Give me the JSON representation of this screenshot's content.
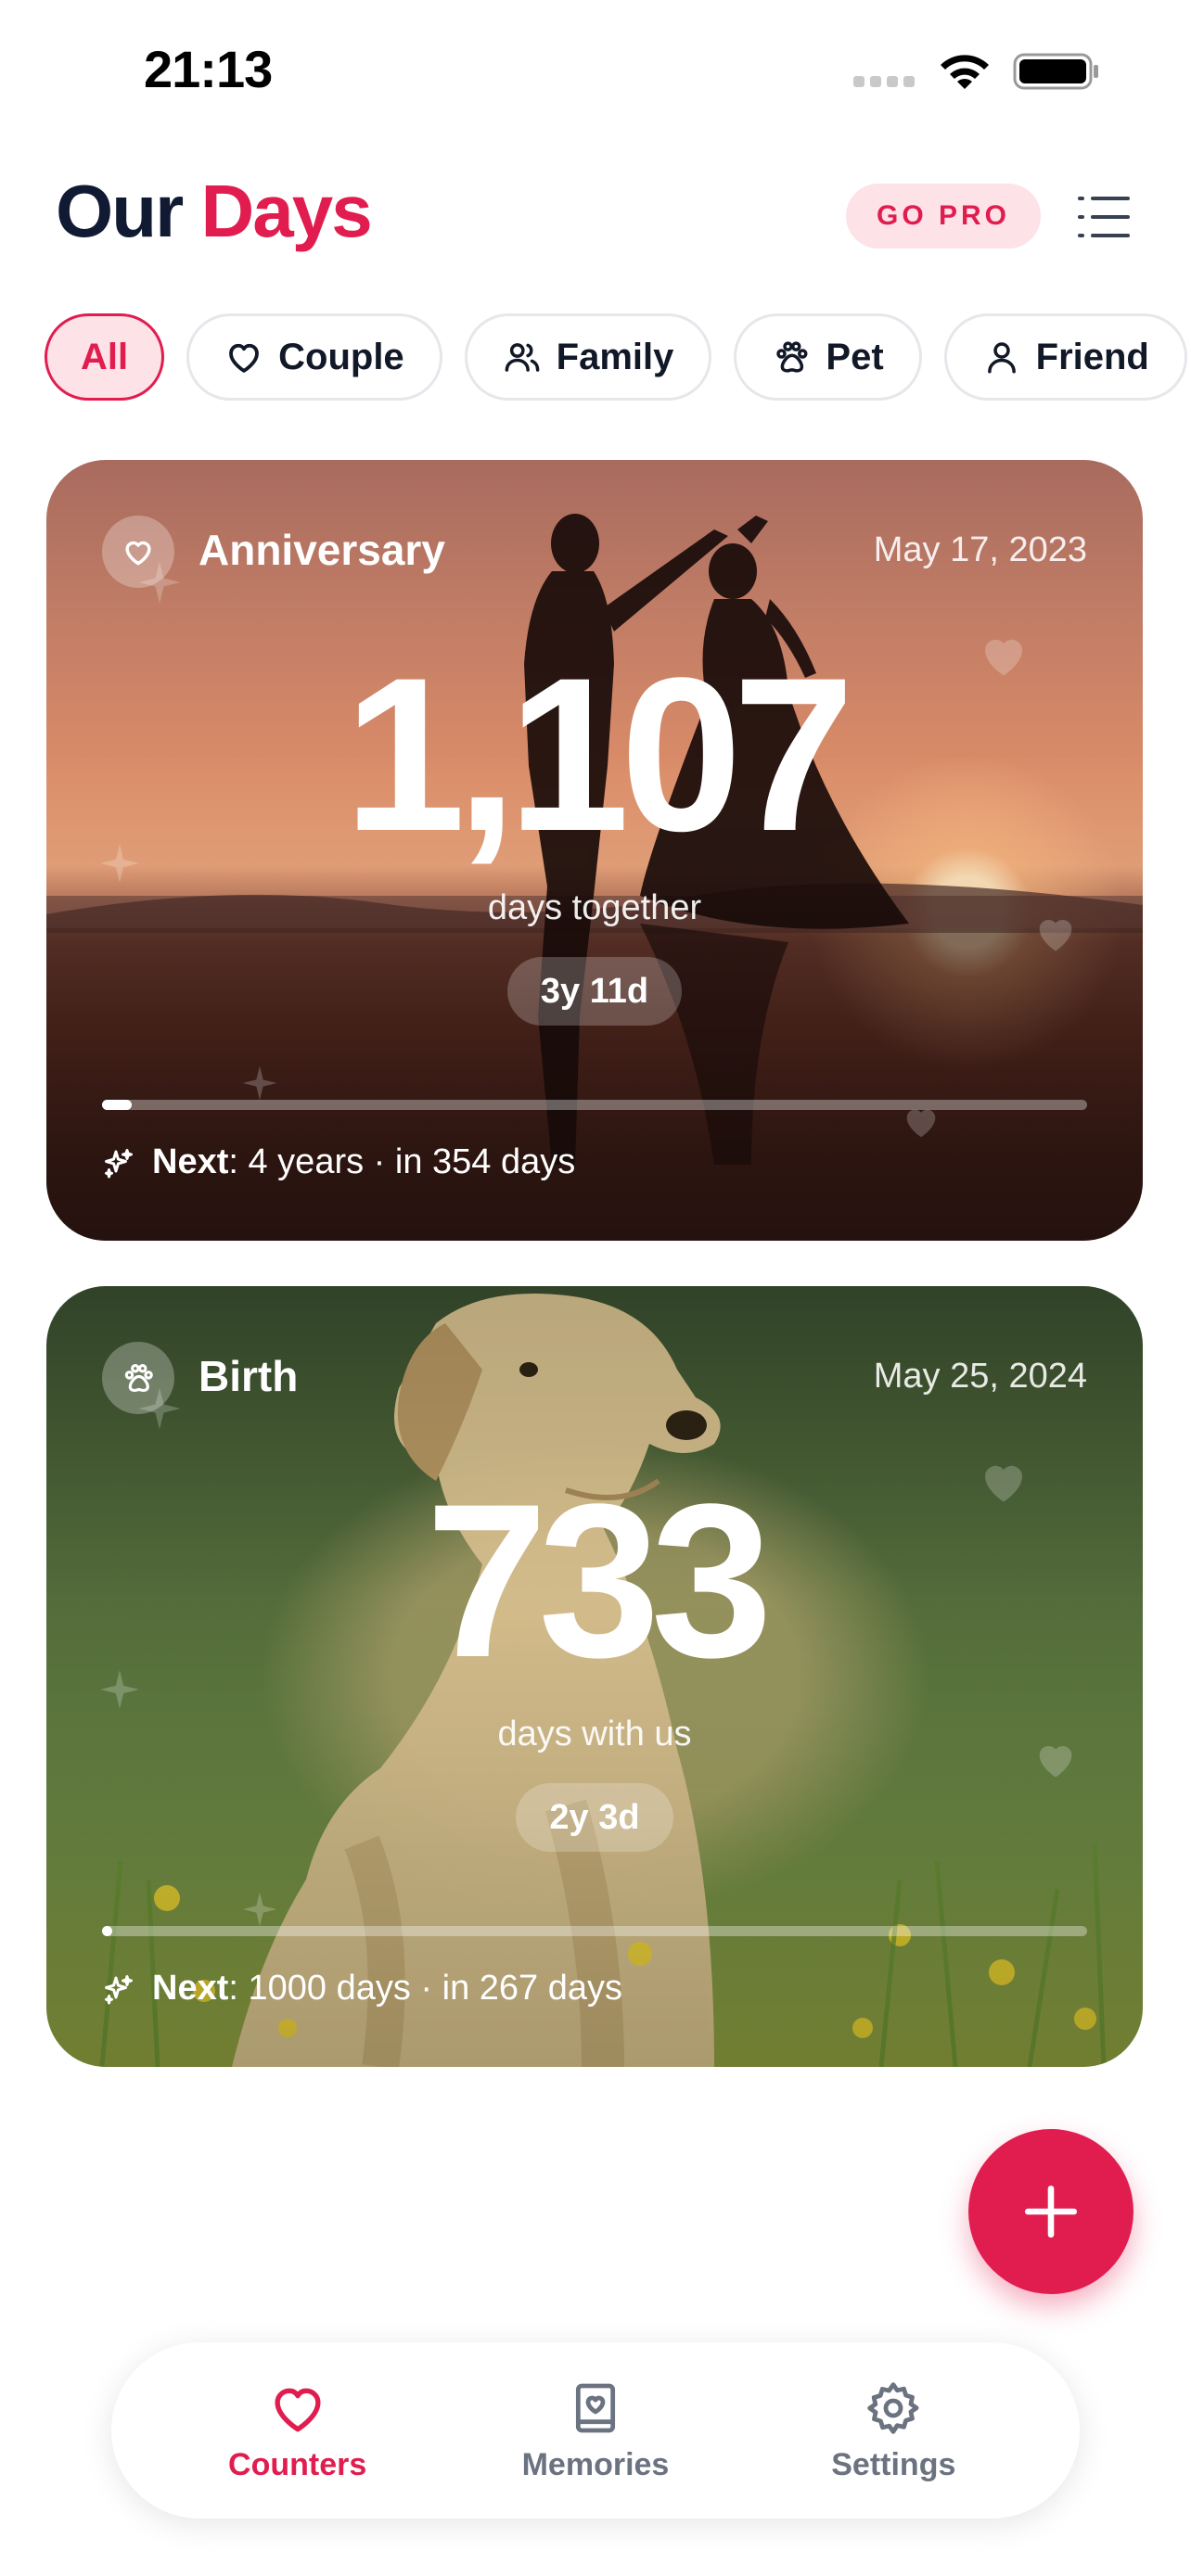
{
  "status_bar": {
    "time": "21:13"
  },
  "header": {
    "title_part1": "Our",
    "title_part2": "Days",
    "go_pro_label": "GO PRO"
  },
  "filters": [
    {
      "label": "All",
      "icon": "none",
      "active": true
    },
    {
      "label": "Couple",
      "icon": "heart-icon",
      "active": false
    },
    {
      "label": "Family",
      "icon": "people-icon",
      "active": false
    },
    {
      "label": "Pet",
      "icon": "paw-icon",
      "active": false
    },
    {
      "label": "Friend",
      "icon": "person-icon",
      "active": false
    }
  ],
  "cards": [
    {
      "label": "Anniversary",
      "icon": "heart-icon",
      "date": "May 17, 2023",
      "count": "1,107",
      "subtitle": "days together",
      "duration": "3y 11d",
      "progress": 0.03,
      "next_label": "Next",
      "next_text": ": 4 years · in 354 days"
    },
    {
      "label": "Birth",
      "icon": "paw-icon",
      "date": "May 25, 2024",
      "count": "733",
      "subtitle": "days with us",
      "duration": "2y 3d",
      "progress": 0.01,
      "next_label": "Next",
      "next_text": ": 1000 days · in 267 days"
    }
  ],
  "fab": {
    "icon": "plus-icon"
  },
  "tab_bar": {
    "items": [
      {
        "label": "Counters",
        "icon": "heart-icon",
        "active": true
      },
      {
        "label": "Memories",
        "icon": "book-heart-icon",
        "active": false
      },
      {
        "label": "Settings",
        "icon": "gear-icon",
        "active": false
      }
    ]
  },
  "colors": {
    "accent": "#e11d4f",
    "accent_soft": "#fde2e8",
    "title_dark": "#111a33",
    "tab_inactive": "#6b7280"
  }
}
